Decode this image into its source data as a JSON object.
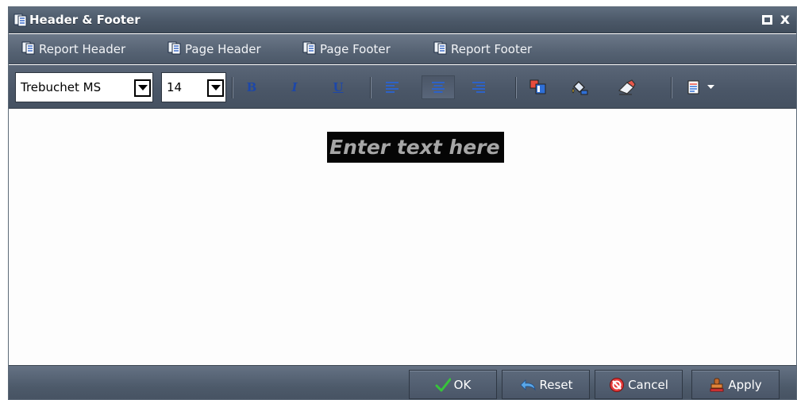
{
  "window": {
    "title": "Header & Footer",
    "close_glyph": "x"
  },
  "sections": [
    {
      "label": "Report Header",
      "icon": "report-header-icon"
    },
    {
      "label": "Page Header",
      "icon": "page-header-icon"
    },
    {
      "label": "Page Footer",
      "icon": "page-footer-icon"
    },
    {
      "label": "Report Footer",
      "icon": "report-footer-icon"
    }
  ],
  "toolbar": {
    "font_family": "Trebuchet MS",
    "font_size": "14",
    "bold": "B",
    "italic": "I",
    "underline": "U",
    "align_active": "center"
  },
  "editor": {
    "text": "Enter text here",
    "text_color": "#a6a6a6",
    "background_color": "#050505"
  },
  "buttons": {
    "ok": "OK",
    "reset": "Reset",
    "cancel": "Cancel",
    "apply": "Apply"
  }
}
